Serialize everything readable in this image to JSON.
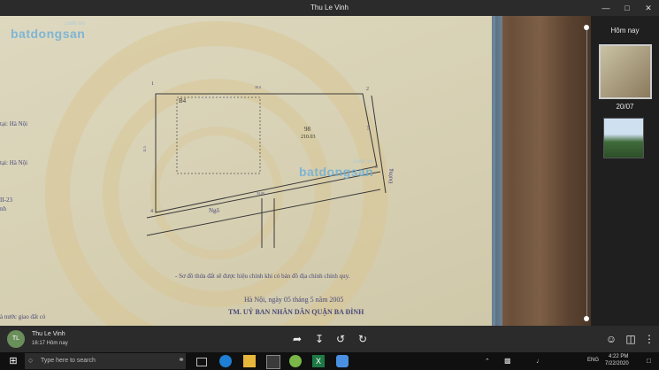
{
  "window": {
    "title": "Thu Le Vinh",
    "minimize_icon": "minimize-icon",
    "maximize_icon": "maximize-icon",
    "close_icon": "close-icon"
  },
  "photo": {
    "watermark_top": "batdongsan",
    "watermark_top_sub": ".com.vn",
    "watermark_mid": "batdongsan",
    "watermark_mid_sub": ".com.vn",
    "plot_id": "B4",
    "parcel_no": "98",
    "parcel_area": "210.03",
    "corner_1": "1",
    "corner_2": "2",
    "corner_3": "3",
    "corner_4": "4",
    "dim_top": "30.0",
    "dim_left": "11.5",
    "dim_right": "5.8",
    "dim_bottom": "33.09",
    "road_label": "Đường",
    "alley_label": "Ngõ",
    "left_frag_1": "tại:  Hà Nội",
    "left_frag_2": "tại:  Hà Nội",
    "left_frag_3": "II-23",
    "left_frag_4": "nh",
    "left_frag_5": "à nước giao đất có",
    "note_line": "- Sơ đồ thửa đất sẽ được hiệu chỉnh khi có bản đồ địa chính chính quy.",
    "date_line": "Hà Nội, ngày  05  tháng  5  năm 2005",
    "signature_line": "TM. UỶ BAN NHÂN DÂN QUẬN BA ĐÌNH"
  },
  "right_panel": {
    "today_label": "Hôm nay",
    "date_label": "20/07"
  },
  "bottom_bar": {
    "avatar_initials": "TL",
    "user_name": "Thu Le Vinh",
    "user_time": "16:17 Hôm nay"
  },
  "taskbar": {
    "search_placeholder": "Type here to search",
    "lang": "ENG",
    "time": "4:22 PM",
    "date": "7/22/2020"
  }
}
